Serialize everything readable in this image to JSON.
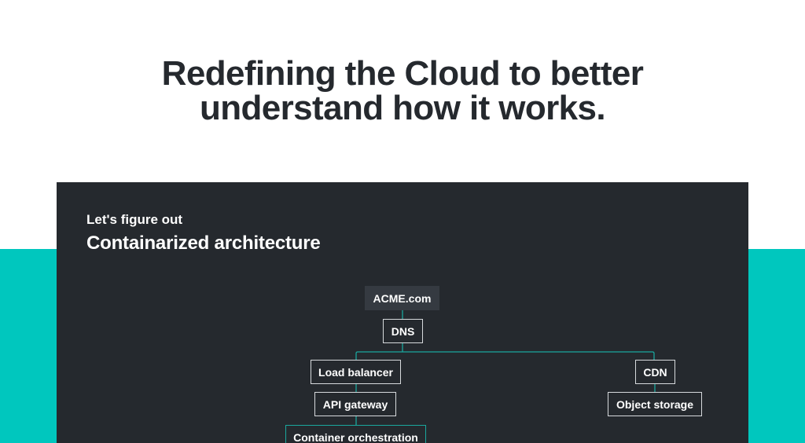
{
  "hero": {
    "headline_line1": "Redefining the Cloud to better",
    "headline_line2": "understand how it works."
  },
  "panel": {
    "eyebrow": "Let's figure out",
    "title": "Containarized architecture"
  },
  "diagram": {
    "nodes": {
      "root": "ACME.com",
      "dns": "DNS",
      "load_balancer": "Load balancer",
      "cdn": "CDN",
      "api_gateway": "API gateway",
      "object_storage": "Object storage",
      "container_orchestration": "Container orchestration"
    }
  },
  "colors": {
    "accent": "#00c7be",
    "panel": "#25292e",
    "text_dark": "#25292e"
  }
}
